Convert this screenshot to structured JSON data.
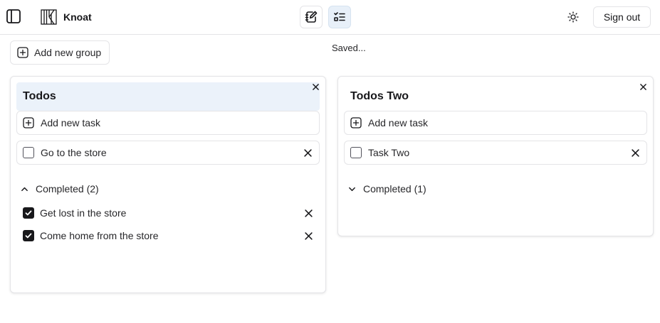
{
  "app": {
    "title": "Knoat"
  },
  "header": {
    "sidebar_toggle_icon": "sidebar-icon",
    "logo_icon": "knoat-logo",
    "notes_icon": "notebook-pen-icon",
    "list_icon": "list-checks-icon",
    "theme_icon": "sun-icon",
    "sign_out_label": "Sign out",
    "active_view": "list"
  },
  "toolbar": {
    "add_group_label": "Add new group",
    "add_group_icon": "plus-square-icon",
    "status_text": "Saved..."
  },
  "groups": [
    {
      "title": "Todos",
      "add_task_label": "Add new task",
      "tasks": [
        {
          "label": "Go to the store",
          "checked": false
        }
      ],
      "completed_label": "Completed (2)",
      "completed_expanded": true,
      "completed": [
        {
          "label": "Get lost in the store",
          "checked": true
        },
        {
          "label": "Come home from the store",
          "checked": true
        }
      ]
    },
    {
      "title": "Todos Two",
      "add_task_label": "Add new task",
      "tasks": [
        {
          "label": "Task Two",
          "checked": false
        }
      ],
      "completed_label": "Completed (1)",
      "completed_expanded": false,
      "completed": []
    }
  ],
  "colors": {
    "accent_bg": "#e8f0f9",
    "highlight_title_bg": "#ebf2fa",
    "border": "#e4e4e7",
    "text": "#18181b"
  }
}
